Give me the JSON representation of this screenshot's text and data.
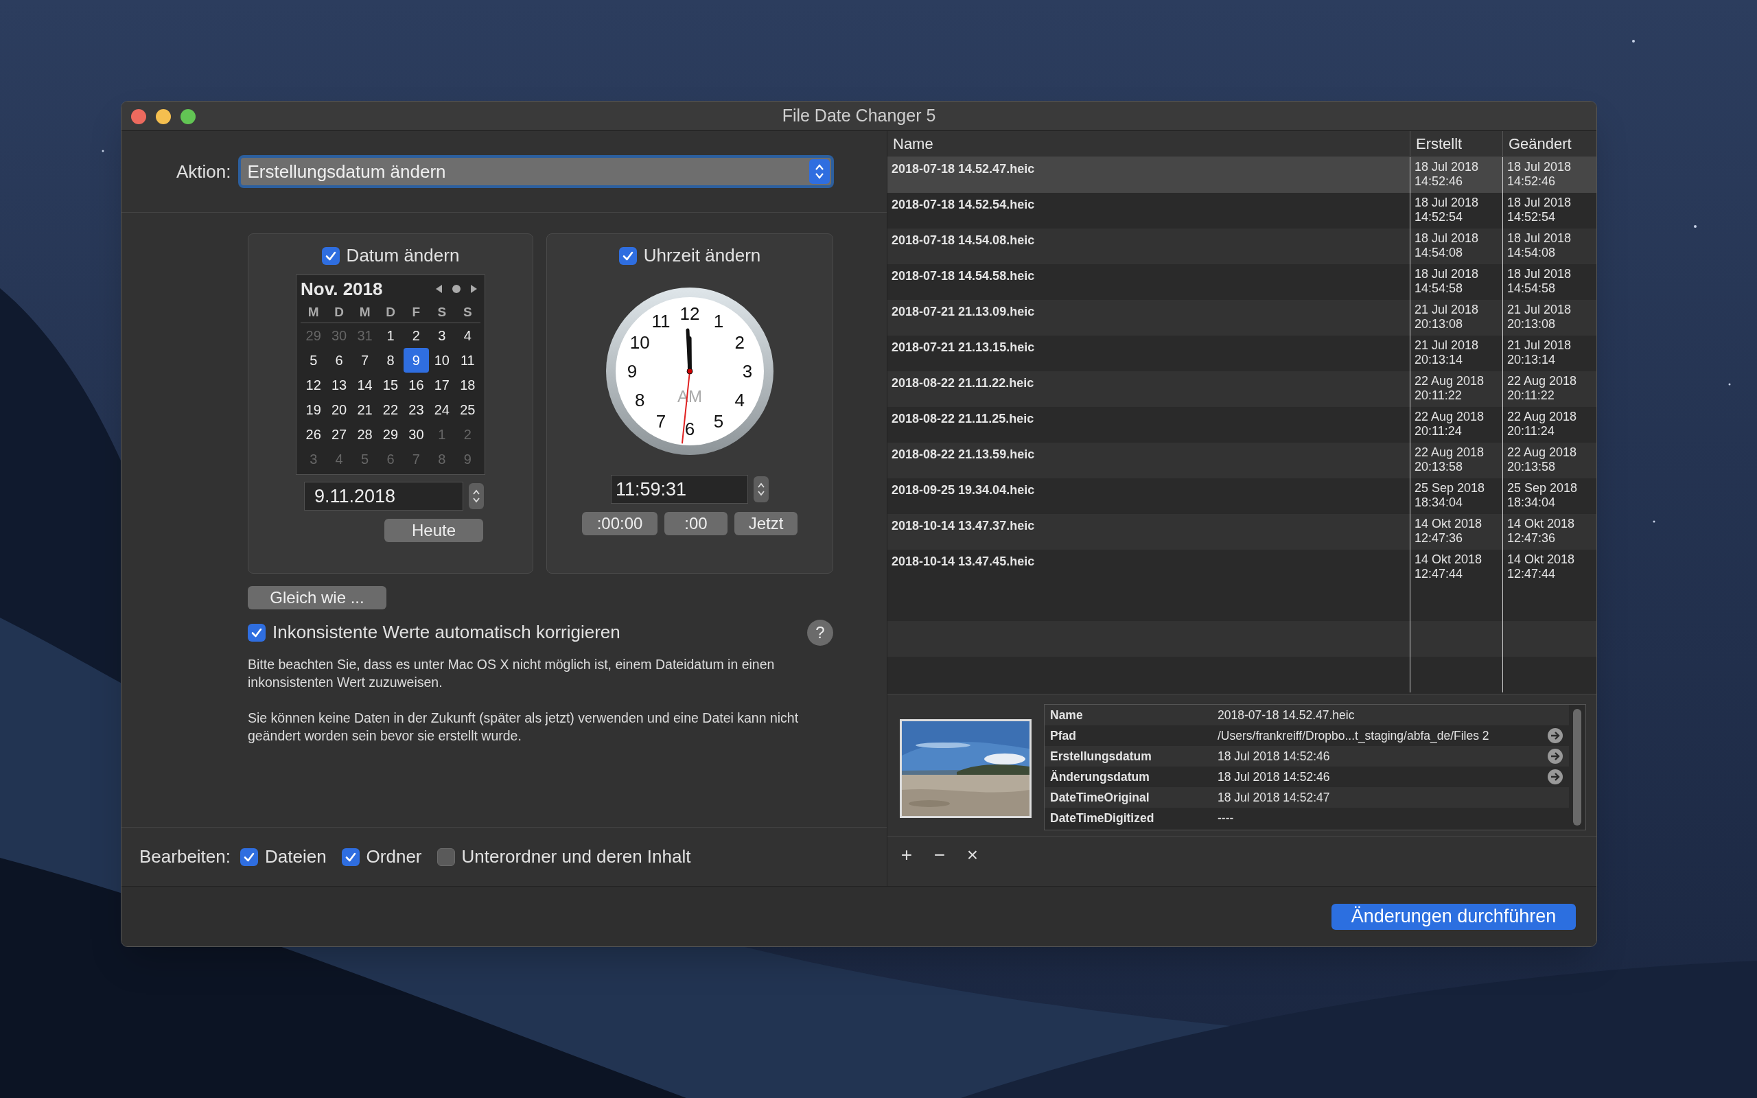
{
  "window": {
    "title": "File Date Changer 5"
  },
  "action": {
    "label": "Aktion:",
    "value": "Erstellungsdatum ändern"
  },
  "date_group": {
    "label": "Datum ändern",
    "checked": true,
    "calendar": {
      "title": "Nov. 2018",
      "weekdays": [
        "M",
        "D",
        "M",
        "D",
        "F",
        "S",
        "S"
      ],
      "weeks": [
        [
          {
            "day": "29",
            "outside": true,
            "selected": false
          },
          {
            "day": "30",
            "outside": true,
            "selected": false
          },
          {
            "day": "31",
            "outside": true,
            "selected": false
          },
          {
            "day": "1",
            "outside": false,
            "selected": false
          },
          {
            "day": "2",
            "outside": false,
            "selected": false
          },
          {
            "day": "3",
            "outside": false,
            "selected": false
          },
          {
            "day": "4",
            "outside": false,
            "selected": false
          }
        ],
        [
          {
            "day": "5",
            "outside": false,
            "selected": false
          },
          {
            "day": "6",
            "outside": false,
            "selected": false
          },
          {
            "day": "7",
            "outside": false,
            "selected": false
          },
          {
            "day": "8",
            "outside": false,
            "selected": false
          },
          {
            "day": "9",
            "outside": false,
            "selected": true
          },
          {
            "day": "10",
            "outside": false,
            "selected": false
          },
          {
            "day": "11",
            "outside": false,
            "selected": false
          }
        ],
        [
          {
            "day": "12",
            "outside": false,
            "selected": false
          },
          {
            "day": "13",
            "outside": false,
            "selected": false
          },
          {
            "day": "14",
            "outside": false,
            "selected": false
          },
          {
            "day": "15",
            "outside": false,
            "selected": false
          },
          {
            "day": "16",
            "outside": false,
            "selected": false
          },
          {
            "day": "17",
            "outside": false,
            "selected": false
          },
          {
            "day": "18",
            "outside": false,
            "selected": false
          }
        ],
        [
          {
            "day": "19",
            "outside": false,
            "selected": false
          },
          {
            "day": "20",
            "outside": false,
            "selected": false
          },
          {
            "day": "21",
            "outside": false,
            "selected": false
          },
          {
            "day": "22",
            "outside": false,
            "selected": false
          },
          {
            "day": "23",
            "outside": false,
            "selected": false
          },
          {
            "day": "24",
            "outside": false,
            "selected": false
          },
          {
            "day": "25",
            "outside": false,
            "selected": false
          }
        ],
        [
          {
            "day": "26",
            "outside": false,
            "selected": false
          },
          {
            "day": "27",
            "outside": false,
            "selected": false
          },
          {
            "day": "28",
            "outside": false,
            "selected": false
          },
          {
            "day": "29",
            "outside": false,
            "selected": false
          },
          {
            "day": "30",
            "outside": false,
            "selected": false
          },
          {
            "day": "1",
            "outside": true,
            "selected": false
          },
          {
            "day": "2",
            "outside": true,
            "selected": false
          }
        ],
        [
          {
            "day": "3",
            "outside": true,
            "selected": false
          },
          {
            "day": "4",
            "outside": true,
            "selected": false
          },
          {
            "day": "5",
            "outside": true,
            "selected": false
          },
          {
            "day": "6",
            "outside": true,
            "selected": false
          },
          {
            "day": "7",
            "outside": true,
            "selected": false
          },
          {
            "day": "8",
            "outside": true,
            "selected": false
          },
          {
            "day": "9",
            "outside": true,
            "selected": false
          }
        ]
      ]
    },
    "value": "9.11.2018",
    "button": "Heute"
  },
  "time_group": {
    "label": "Uhrzeit ändern",
    "checked": true,
    "clock": {
      "numerals": [
        "12",
        "11",
        "1",
        "10",
        "2",
        "9",
        "3",
        "8",
        "4",
        "7",
        "5",
        "6"
      ],
      "meridiem": "AM"
    },
    "value": "11:59:31",
    "buttons": [
      ":00:00",
      ":00",
      "Jetzt"
    ]
  },
  "same_as_button": "Gleich wie ...",
  "autocorrect": {
    "label": "Inkonsistente Werte automatisch korrigieren",
    "checked": true,
    "help": "?"
  },
  "notes": [
    "Bitte beachten Sie, dass es unter Mac OS X nicht möglich ist, einem Dateidatum in einen inkonsistenten Wert zuzuweisen.",
    "Sie können keine Daten in der Zukunft (später als jetzt) verwenden und eine Datei kann nicht geändert worden sein bevor sie erstellt wurde."
  ],
  "edit": {
    "label": "Bearbeiten:",
    "options": [
      {
        "label": "Dateien",
        "checked": true
      },
      {
        "label": "Ordner",
        "checked": true
      },
      {
        "label": "Unterordner und deren Inhalt",
        "checked": false
      }
    ]
  },
  "table": {
    "columns": [
      "Name",
      "Erstellt",
      "Geändert"
    ],
    "rows": [
      {
        "name": "2018-07-18 14.52.47.heic",
        "created": "18 Jul 2018 14:52:46",
        "modified": "18 Jul 2018 14:52:46",
        "selected": true
      },
      {
        "name": "2018-07-18 14.52.54.heic",
        "created": "18 Jul 2018 14:52:54",
        "modified": "18 Jul 2018 14:52:54",
        "selected": false
      },
      {
        "name": "2018-07-18 14.54.08.heic",
        "created": "18 Jul 2018 14:54:08",
        "modified": "18 Jul 2018 14:54:08",
        "selected": false
      },
      {
        "name": "2018-07-18 14.54.58.heic",
        "created": "18 Jul 2018 14:54:58",
        "modified": "18 Jul 2018 14:54:58",
        "selected": false
      },
      {
        "name": "2018-07-21 21.13.09.heic",
        "created": "21 Jul 2018 20:13:08",
        "modified": "21 Jul 2018 20:13:08",
        "selected": false
      },
      {
        "name": "2018-07-21 21.13.15.heic",
        "created": "21 Jul 2018 20:13:14",
        "modified": "21 Jul 2018 20:13:14",
        "selected": false
      },
      {
        "name": "2018-08-22 21.11.22.heic",
        "created": "22 Aug 2018 20:11:22",
        "modified": "22 Aug 2018 20:11:22",
        "selected": false
      },
      {
        "name": "2018-08-22 21.11.25.heic",
        "created": "22 Aug 2018 20:11:24",
        "modified": "22 Aug 2018 20:11:24",
        "selected": false
      },
      {
        "name": "2018-08-22 21.13.59.heic",
        "created": "22 Aug 2018 20:13:58",
        "modified": "22 Aug 2018 20:13:58",
        "selected": false
      },
      {
        "name": "2018-09-25 19.34.04.heic",
        "created": "25 Sep 2018 18:34:04",
        "modified": "25 Sep 2018 18:34:04",
        "selected": false
      },
      {
        "name": "2018-10-14 13.47.37.heic",
        "created": "14 Okt 2018 12:47:36",
        "modified": "14 Okt 2018 12:47:36",
        "selected": false
      },
      {
        "name": "2018-10-14 13.47.45.heic",
        "created": "14 Okt 2018 12:47:44",
        "modified": "14 Okt 2018 12:47:44",
        "selected": false
      }
    ]
  },
  "details": {
    "rows": [
      {
        "key": "Name",
        "value": "2018-07-18 14.52.47.heic",
        "arrow": false
      },
      {
        "key": "Pfad",
        "value": "/Users/frankreiff/Dropbo...t_staging/abfa_de/Files 2",
        "arrow": true
      },
      {
        "key": "Erstellungsdatum",
        "value": "18 Jul 2018 14:52:46",
        "arrow": true
      },
      {
        "key": "Änderungsdatum",
        "value": "18 Jul 2018 14:52:46",
        "arrow": true
      },
      {
        "key": "DateTimeOriginal",
        "value": "18 Jul 2018 14:52:47",
        "arrow": false
      },
      {
        "key": "DateTimeDigitized",
        "value": "----",
        "arrow": false
      }
    ]
  },
  "list_toolbar": [
    "+",
    "−",
    "×"
  ],
  "apply_button": "Änderungen durchführen"
}
